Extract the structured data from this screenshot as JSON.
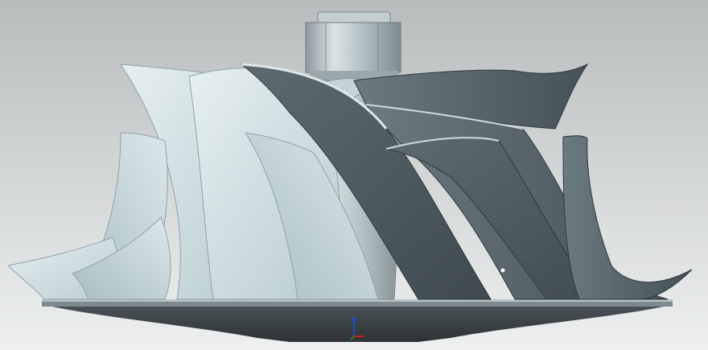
{
  "viewport": {
    "background_top": "#b9bcbd",
    "background_bottom": "#eef0f0",
    "model": "impeller",
    "light_blade_color": "#cfe0e3",
    "dark_blade_color": "#4a575d",
    "shaft_color": "#aab7ba",
    "hub_color": "#3a4146"
  },
  "triad": {
    "x_color": "#d21d1d",
    "y_color": "#1e8a2e",
    "z_color": "#1b4fd0"
  }
}
